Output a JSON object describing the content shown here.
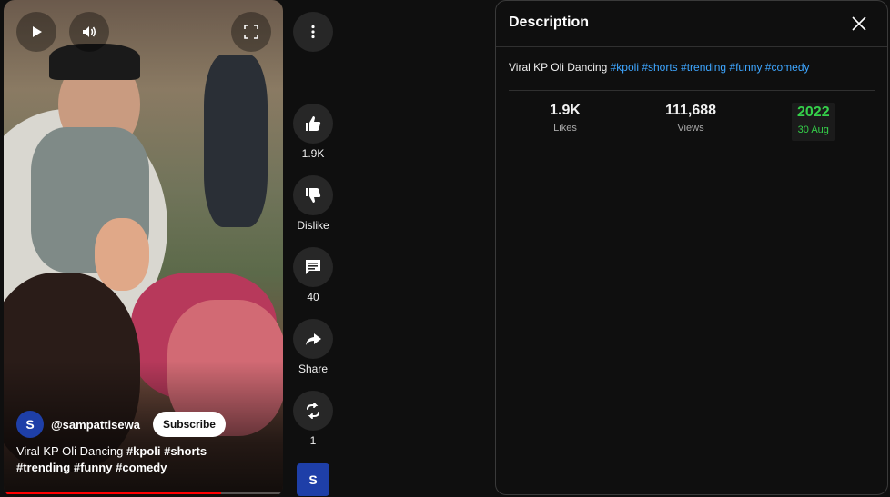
{
  "player": {
    "channel": "@sampattisewa",
    "subscribe_label": "Subscribe",
    "title_plain": "Viral KP Oli Dancing",
    "hashtags": [
      "#kpoli",
      "#shorts",
      "#trending",
      "#funny",
      "#comedy"
    ],
    "progress_fraction": 0.78
  },
  "actions": {
    "likes": "1.9K",
    "dislike_label": "Dislike",
    "comments": "40",
    "share_label": "Share",
    "remix_count": "1"
  },
  "description_panel": {
    "heading": "Description",
    "text_plain": "Viral KP Oli Dancing",
    "hashtags": [
      "#kpoli",
      "#shorts",
      "#trending",
      "#funny",
      "#comedy"
    ],
    "stats": {
      "likes_value": "1.9K",
      "likes_label": "Likes",
      "views_value": "111,688",
      "views_label": "Views",
      "year": "2022",
      "date": "30 Aug"
    }
  },
  "colors": {
    "background": "#0f0f0f",
    "accent_link": "#3ea6ff",
    "progress": "#ff0000",
    "date_highlight": "#35d04a"
  },
  "icons": [
    "play-icon",
    "volume-icon",
    "fullscreen-icon",
    "more-vert-icon",
    "thumb-up-icon",
    "thumb-down-icon",
    "comment-icon",
    "share-icon",
    "remix-icon",
    "close-icon"
  ]
}
